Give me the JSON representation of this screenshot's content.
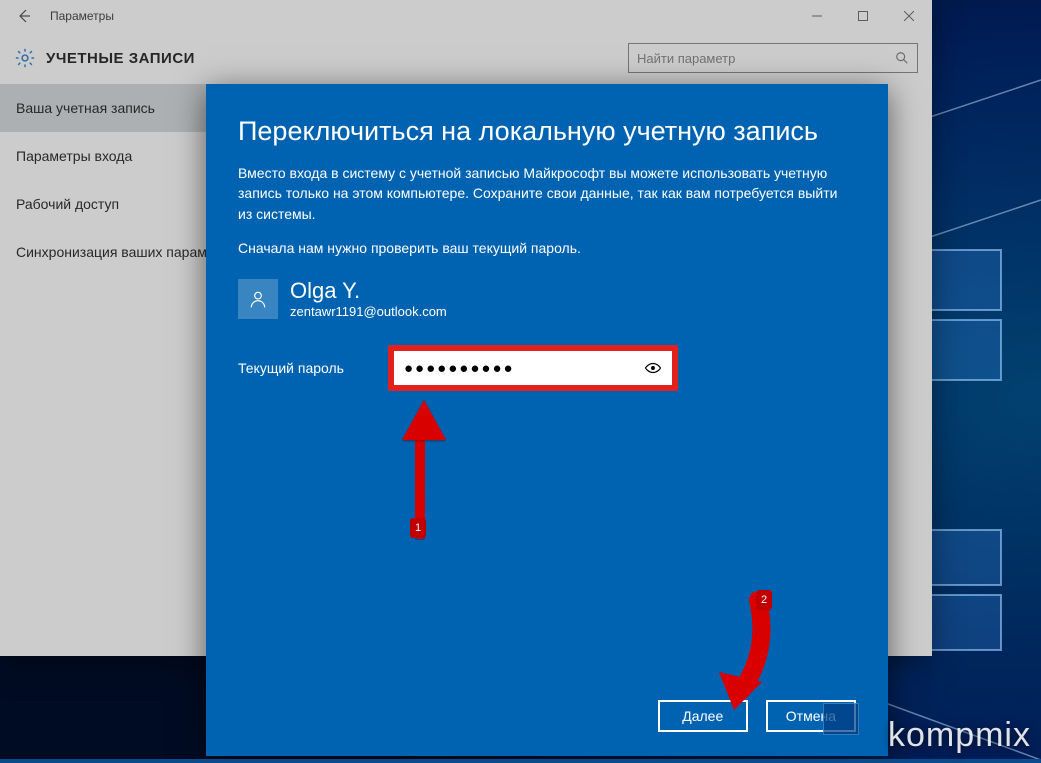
{
  "window": {
    "title": "Параметры",
    "header_title": "УЧЕТНЫЕ ЗАПИСИ",
    "search_placeholder": "Найти параметр"
  },
  "sidebar": {
    "items": [
      {
        "label": "Ваша учетная запись",
        "active": true
      },
      {
        "label": "Параметры входа",
        "active": false
      },
      {
        "label": "Рабочий доступ",
        "active": false
      },
      {
        "label": "Синхронизация ваших параметров",
        "active": false
      }
    ]
  },
  "modal": {
    "title": "Переключиться на локальную учетную запись",
    "paragraph1": "Вместо входа в систему с учетной записью Майкрософт вы можете использовать учетную запись только на этом компьютере. Сохраните свои данные, так как вам потребуется выйти из системы.",
    "paragraph2": "Сначала нам нужно проверить ваш текущий пароль.",
    "user_name": "Olga Y.",
    "user_email": "zentawr1191@outlook.com",
    "password_label": "Текущий пароль",
    "password_value": "●●●●●●●●●●",
    "next_label": "Далее",
    "cancel_label": "Отмена"
  },
  "annotations": {
    "step1": "1",
    "step2": "2"
  },
  "watermark": "kompmix"
}
